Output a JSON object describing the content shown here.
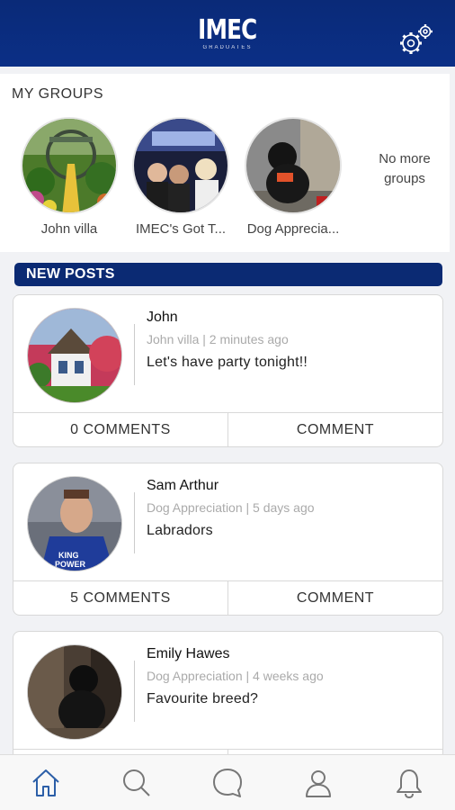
{
  "app": {
    "logo": "IMEC",
    "logo_sub": "GRADUATES"
  },
  "groups": {
    "title": "MY GROUPS",
    "items": [
      {
        "name": "John villa"
      },
      {
        "name": "IMEC's Got T..."
      },
      {
        "name": "Dog Apprecia..."
      }
    ],
    "no_more": "No more groups"
  },
  "new_posts_title": "NEW POSTS",
  "posts": [
    {
      "author": "John",
      "meta": "John villa | 2 minutes ago",
      "text": "Let's have party tonight!!",
      "comments_label": "0 COMMENTS",
      "comment_label": "COMMENT"
    },
    {
      "author": "Sam Arthur",
      "meta": "Dog Appreciation | 5 days ago",
      "text": "Labradors",
      "comments_label": "5 COMMENTS",
      "comment_label": "COMMENT"
    },
    {
      "author": "Emily Hawes",
      "meta": "Dog Appreciation | 4 weeks ago",
      "text": "Favourite breed?"
    }
  ],
  "nav": {
    "items": [
      {
        "icon": "home-icon",
        "active": true
      },
      {
        "icon": "search-icon"
      },
      {
        "icon": "chat-icon"
      },
      {
        "icon": "profile-icon"
      },
      {
        "icon": "bell-icon"
      }
    ]
  },
  "colors": {
    "primary": "#0b2a73",
    "active_icon": "#2c5fa8",
    "inactive_icon": "#777777"
  }
}
